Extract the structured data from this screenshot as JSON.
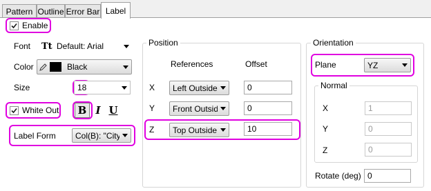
{
  "tabs": [
    {
      "label": "Pattern"
    },
    {
      "label": "Outline"
    },
    {
      "label": "Error Bar"
    },
    {
      "label": "Label"
    }
  ],
  "enable": {
    "label": "Enable",
    "checked": true
  },
  "font": {
    "label": "Font",
    "value": "Default: Arial",
    "icon_text": "Tt"
  },
  "color": {
    "label": "Color",
    "value": "Black",
    "swatch": "#000000"
  },
  "size": {
    "label": "Size",
    "value": "18"
  },
  "white_out": {
    "label": "White Out",
    "checked": true
  },
  "format_buttons": {
    "bold": "B",
    "italic": "I",
    "underline": "U"
  },
  "label_form": {
    "label": "Label Form",
    "value": "Col(B): \"City\""
  },
  "position": {
    "title": "Position",
    "col_references": "References",
    "col_offset": "Offset",
    "rows": [
      {
        "axis": "X",
        "reference": "Left Outside",
        "offset": "0"
      },
      {
        "axis": "Y",
        "reference": "Front Outside",
        "offset": "0"
      },
      {
        "axis": "Z",
        "reference": "Top Outside",
        "offset": "10"
      }
    ]
  },
  "orientation": {
    "title": "Orientation",
    "plane_label": "Plane",
    "plane_value": "YZ",
    "normal_title": "Normal",
    "normal": [
      {
        "axis": "X",
        "value": "1"
      },
      {
        "axis": "Y",
        "value": "0"
      },
      {
        "axis": "Z",
        "value": "0"
      }
    ],
    "rotate_label": "Rotate (deg)",
    "rotate_value": "0"
  },
  "highlight_color": "#e000e0"
}
